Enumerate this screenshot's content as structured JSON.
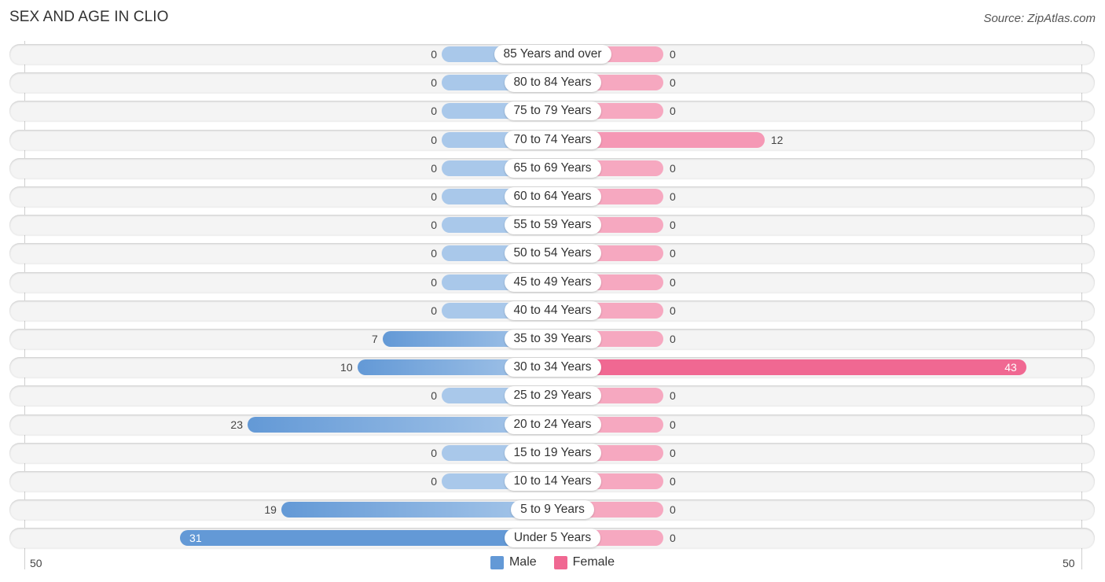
{
  "title": "SEX AND AGE IN CLIO",
  "source": "Source: ZipAtlas.com",
  "colors": {
    "male_strong": "#6399d6",
    "male_light": "#a9c8ea",
    "female_strong": "#f06892",
    "female_light": "#f6a8c0"
  },
  "chart_data": {
    "type": "bar",
    "orientation": "horizontal-diverging",
    "title": "SEX AND AGE IN CLIO",
    "categories": [
      "85 Years and over",
      "80 to 84 Years",
      "75 to 79 Years",
      "70 to 74 Years",
      "65 to 69 Years",
      "60 to 64 Years",
      "55 to 59 Years",
      "50 to 54 Years",
      "45 to 49 Years",
      "40 to 44 Years",
      "35 to 39 Years",
      "30 to 34 Years",
      "25 to 29 Years",
      "20 to 24 Years",
      "15 to 19 Years",
      "10 to 14 Years",
      "5 to 9 Years",
      "Under 5 Years"
    ],
    "series": [
      {
        "name": "Male",
        "values": [
          0,
          0,
          0,
          0,
          0,
          0,
          0,
          0,
          0,
          0,
          7,
          10,
          0,
          23,
          0,
          0,
          19,
          31
        ]
      },
      {
        "name": "Female",
        "values": [
          0,
          0,
          0,
          12,
          0,
          0,
          0,
          0,
          0,
          0,
          0,
          43,
          0,
          0,
          0,
          0,
          0,
          0
        ]
      }
    ],
    "axis": {
      "left_label": "50",
      "right_label": "50",
      "range": [
        -50,
        50
      ]
    },
    "legend": {
      "position": "bottom-center",
      "entries": [
        "Male",
        "Female"
      ]
    },
    "grid": false
  }
}
